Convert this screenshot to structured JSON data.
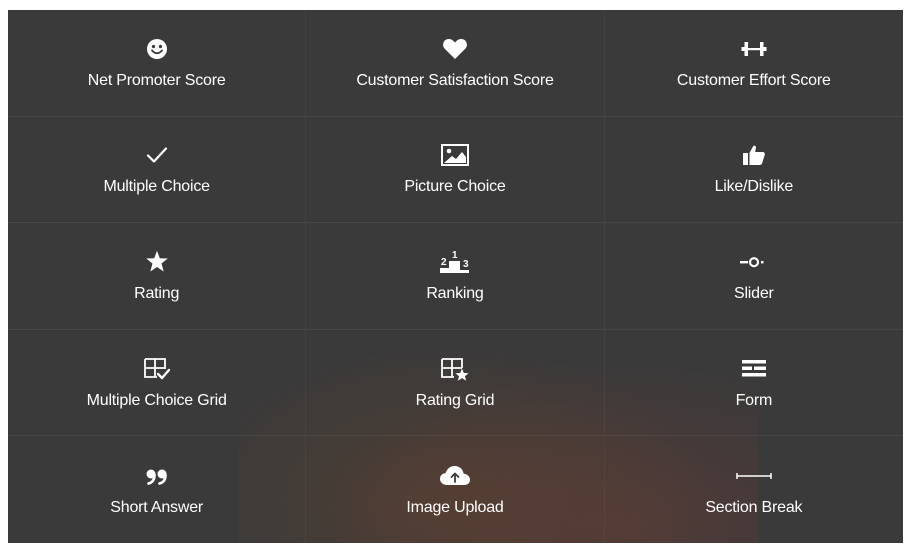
{
  "question_types": [
    {
      "label": "Net Promoter Score",
      "icon": "smiley-icon"
    },
    {
      "label": "Customer Satisfaction Score",
      "icon": "heart-icon"
    },
    {
      "label": "Customer Effort Score",
      "icon": "dumbbell-icon"
    },
    {
      "label": "Multiple Choice",
      "icon": "checkmark-icon"
    },
    {
      "label": "Picture Choice",
      "icon": "picture-icon"
    },
    {
      "label": "Like/Dislike",
      "icon": "thumbs-up-icon"
    },
    {
      "label": "Rating",
      "icon": "star-icon"
    },
    {
      "label": "Ranking",
      "icon": "podium-icon"
    },
    {
      "label": "Slider",
      "icon": "slider-icon"
    },
    {
      "label": "Multiple Choice Grid",
      "icon": "grid-check-icon"
    },
    {
      "label": "Rating Grid",
      "icon": "grid-star-icon"
    },
    {
      "label": "Form",
      "icon": "form-icon"
    },
    {
      "label": "Short Answer",
      "icon": "quote-icon"
    },
    {
      "label": "Image Upload",
      "icon": "cloud-upload-icon"
    },
    {
      "label": "Section Break",
      "icon": "section-break-icon"
    }
  ],
  "ranking_icon_digits": [
    "2",
    "1",
    "3"
  ],
  "colors": {
    "panel": "#3a3a3a",
    "text": "#ffffff"
  }
}
